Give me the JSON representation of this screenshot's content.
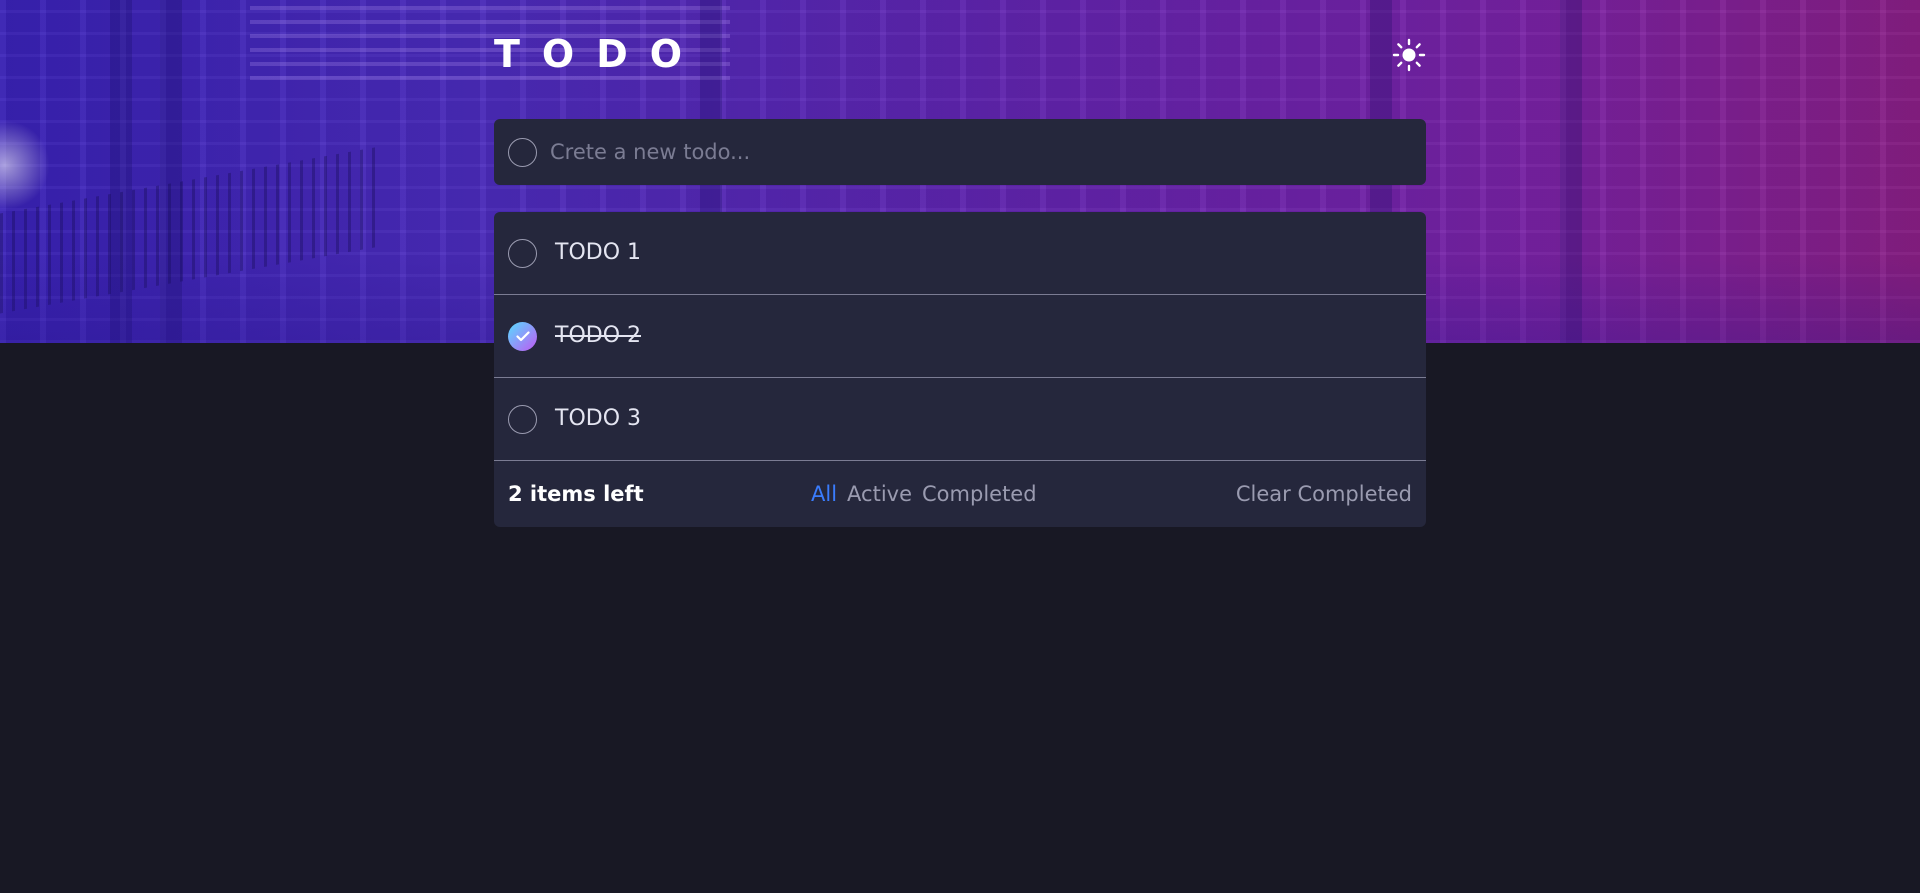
{
  "app": {
    "title": "TODO"
  },
  "theme_toggle": {
    "icon": "sun-icon"
  },
  "new_todo": {
    "placeholder": "Crete a new todo...",
    "value": ""
  },
  "todos": [
    {
      "label": "TODO 1",
      "completed": false
    },
    {
      "label": "TODO 2",
      "completed": true
    },
    {
      "label": "TODO 3",
      "completed": false
    }
  ],
  "footer": {
    "items_left": "2 items left",
    "filters": [
      "All",
      "Active",
      "Completed"
    ],
    "active_filter": "All",
    "clear_label": "Clear Completed"
  },
  "colors": {
    "background": "#181824",
    "card": "#25273c",
    "accent": "#3a7cfd",
    "check_gradient_start": "#57ddff",
    "check_gradient_end": "#c058f3"
  }
}
